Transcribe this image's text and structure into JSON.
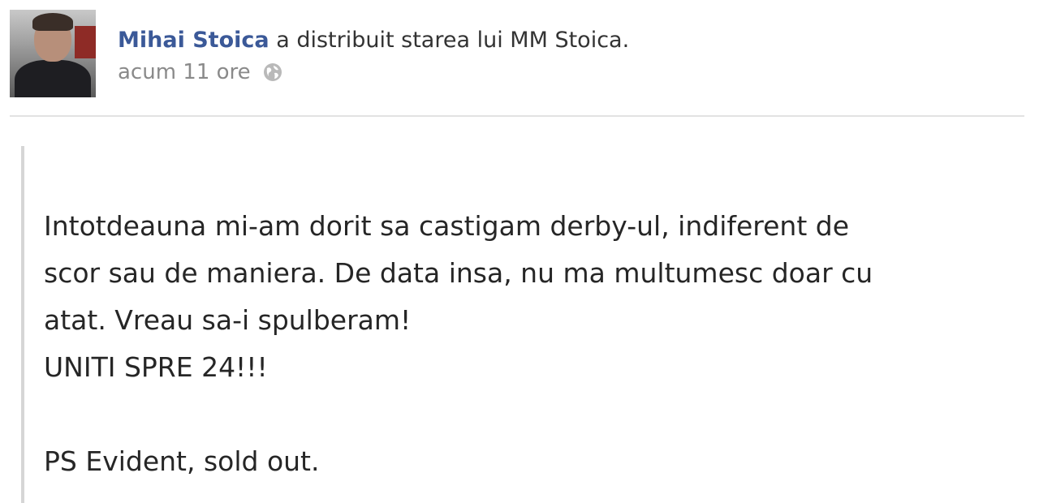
{
  "post": {
    "author": "Mihai Stoica",
    "action": " a distribuit starea lui MM Stoica.",
    "timestamp": "acum 11 ore",
    "privacy_icon": "globe-icon"
  },
  "shared_status": {
    "lines": [
      "Intotdeauna mi-am dorit sa castigam derby-ul, indiferent de",
      "scor sau de maniera. De data insa, nu ma multumesc doar cu",
      "atat. Vreau sa-i spulberam!",
      "UNITI SPRE 24!!!",
      "",
      "PS Evident, sold out."
    ]
  },
  "colors": {
    "link": "#3b5998",
    "meta": "#8a8a8a",
    "text": "#262626"
  }
}
